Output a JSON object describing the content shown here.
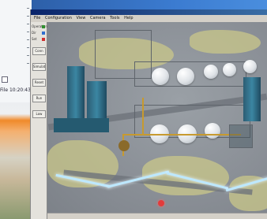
{
  "left_panel": {
    "status_text": "File  10:20:43"
  },
  "window": {
    "menu": [
      "File",
      "Configuration",
      "View",
      "Camera",
      "Tools",
      "Help"
    ]
  },
  "toolbar": {
    "items": [
      {
        "label": "Operation",
        "kind": "label"
      },
      {
        "label": "Dir",
        "kind": "label"
      },
      {
        "label": "Set",
        "kind": "label"
      },
      {
        "label": "Conn",
        "kind": "button"
      },
      {
        "label": "Simulation",
        "kind": "button"
      },
      {
        "label": "Reset",
        "kind": "button"
      },
      {
        "label": "Run",
        "kind": "button"
      },
      {
        "label": "Low Billet",
        "kind": "button"
      }
    ],
    "status_colors": [
      "#2f8f2f",
      "#2f6fd0",
      "#d03030"
    ]
  },
  "viewport": {
    "colors": {
      "ground": "#c9c78a",
      "tank": "#dfe3e7",
      "structure": "#3b86a2",
      "pipe": "#c79a2f",
      "marker": "#e23b3b"
    }
  }
}
